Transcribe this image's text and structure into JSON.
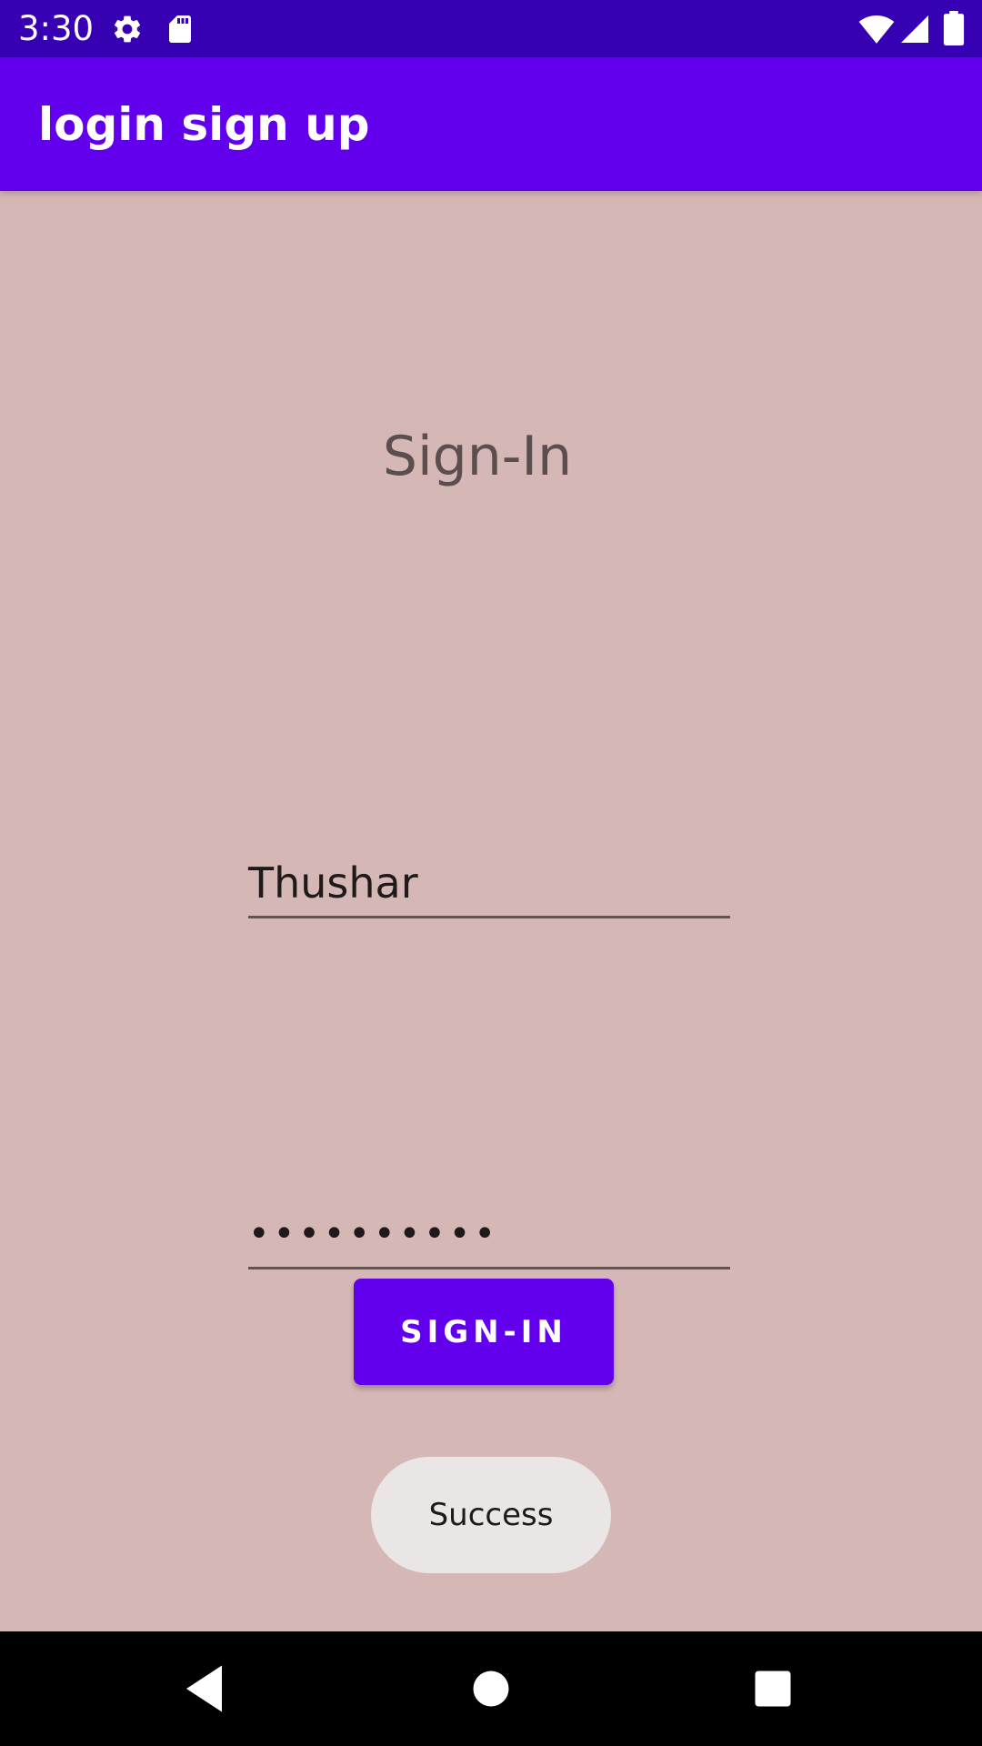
{
  "status_bar": {
    "time": "3:30",
    "icons": [
      "gear-icon",
      "sd-card-icon",
      "wifi-icon",
      "signal-icon",
      "battery-icon"
    ]
  },
  "app_bar": {
    "title": "login sign up"
  },
  "form": {
    "heading": "Sign-In",
    "username_value": "Thushar",
    "password_value": "••••••••••",
    "submit_label": "SIGN-IN"
  },
  "toast": {
    "message": "Success"
  },
  "nav_bar": {
    "icons": [
      "back-icon",
      "home-icon",
      "recents-icon"
    ]
  },
  "colors": {
    "status_bar": "#3700B3",
    "app_bar": "#6200EE",
    "background": "#D5B7B5",
    "button": "#6200EE",
    "toast": "#EAE6E5"
  }
}
